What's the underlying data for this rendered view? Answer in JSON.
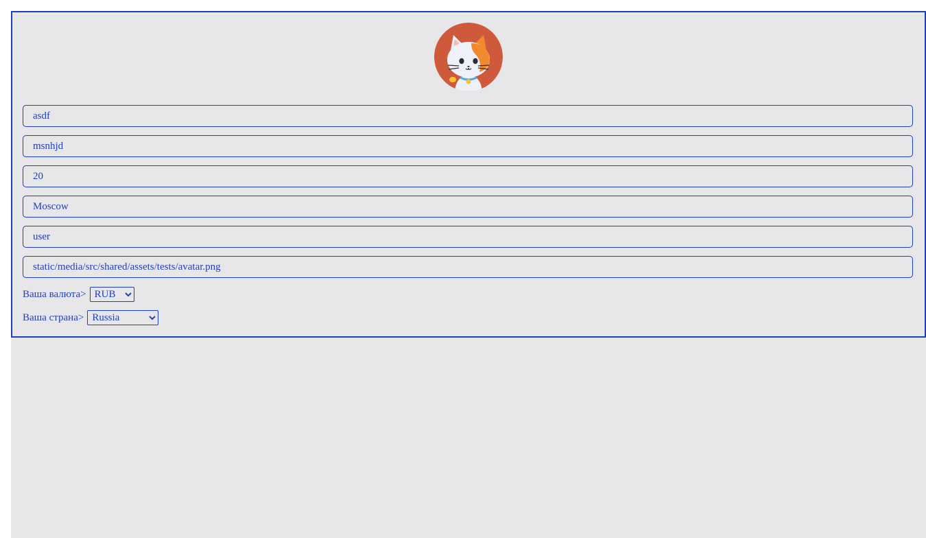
{
  "avatar": {
    "alt": "avatar",
    "bg_color": "#c8523a"
  },
  "profile": {
    "first_name": "asdf",
    "last_name": "msnhjd",
    "age": "20",
    "city": "Moscow",
    "username": "user",
    "avatar_path": "static/media/src/shared/assets/tests/avatar.png"
  },
  "currency": {
    "label": "Ваша валюта>",
    "selected": "RUB"
  },
  "country": {
    "label": "Ваша страна>",
    "selected": "Russia"
  },
  "colors": {
    "primary": "#1f3fbf",
    "background": "#e7e7ea"
  }
}
